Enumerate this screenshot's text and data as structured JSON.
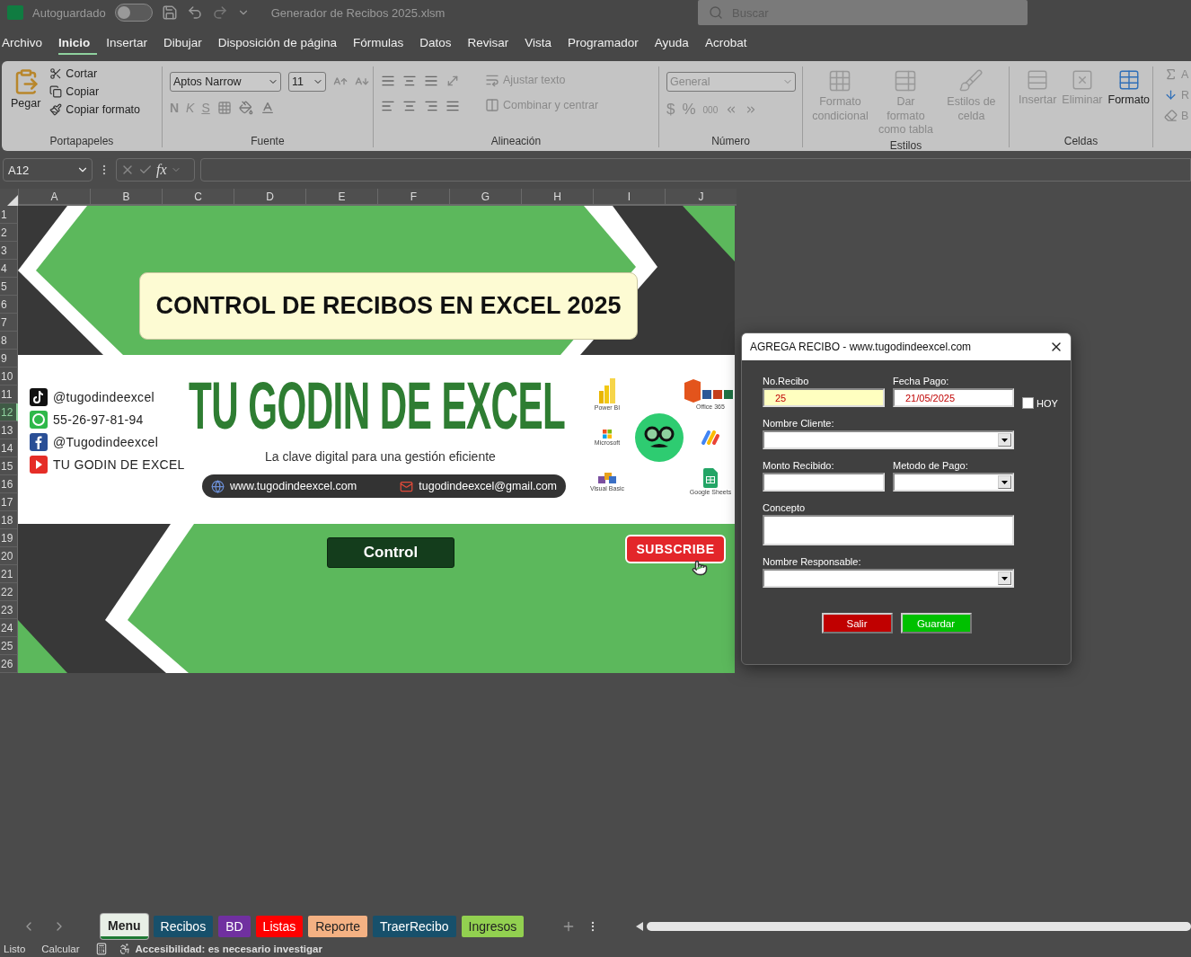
{
  "title_bar": {
    "autosave_label": "Autoguardado",
    "autosave_on": false,
    "filename": "Generador de Recibos 2025.xlsm",
    "search_placeholder": "Buscar"
  },
  "menu_tabs": [
    {
      "label": "Archivo",
      "selected": false
    },
    {
      "label": "Inicio",
      "selected": true
    },
    {
      "label": "Insertar",
      "selected": false
    },
    {
      "label": "Dibujar",
      "selected": false
    },
    {
      "label": "Disposición de página",
      "selected": false
    },
    {
      "label": "Fórmulas",
      "selected": false
    },
    {
      "label": "Datos",
      "selected": false
    },
    {
      "label": "Revisar",
      "selected": false
    },
    {
      "label": "Vista",
      "selected": false
    },
    {
      "label": "Programador",
      "selected": false
    },
    {
      "label": "Ayuda",
      "selected": false
    },
    {
      "label": "Acrobat",
      "selected": false
    }
  ],
  "ribbon": {
    "clipboard": {
      "label": "Portapapeles",
      "paste": "Pegar",
      "actions": [
        {
          "kind": "cut",
          "label": "Cortar"
        },
        {
          "kind": "copy",
          "label": "Copiar"
        },
        {
          "kind": "painter",
          "label": "Copiar formato"
        }
      ]
    },
    "font": {
      "label": "Fuente",
      "font_name": "Aptos Narrow",
      "font_size": "11",
      "styles": [
        "N",
        "K",
        "S"
      ]
    },
    "alignment": {
      "label": "Alineación",
      "actions": [
        {
          "kind": "wrap",
          "label": "Ajustar texto",
          "disabled": true
        },
        {
          "kind": "merge",
          "label": "Combinar y centrar",
          "disabled": true
        }
      ]
    },
    "number": {
      "label": "Número",
      "format": "General",
      "symbols": [
        "$",
        "%",
        "000"
      ]
    },
    "styles": {
      "label": "Estilos",
      "actions": [
        {
          "kind": "conditional",
          "label": "Formato condicional",
          "disabled": true
        },
        {
          "kind": "table",
          "label": "Dar formato como tabla",
          "disabled": true
        },
        {
          "kind": "cell",
          "label": "Estilos de celda",
          "disabled": true
        }
      ]
    },
    "cells": {
      "label": "Celdas",
      "actions": [
        {
          "kind": "insert",
          "label": "Insertar",
          "disabled": true
        },
        {
          "kind": "delete",
          "label": "Eliminar",
          "disabled": true
        },
        {
          "kind": "format",
          "label": "Formato",
          "disabled": false
        }
      ]
    },
    "editing": [
      {
        "kind": "sum",
        "label": "A"
      },
      {
        "kind": "fill",
        "label": "R"
      },
      {
        "kind": "clear",
        "label": "B"
      }
    ]
  },
  "formula_bar": {
    "name_box": "A12",
    "fx": "fx"
  },
  "columns": [
    "A",
    "B",
    "C",
    "D",
    "E",
    "F",
    "G",
    "H",
    "I",
    "J"
  ],
  "rows": [
    {
      "label": "1",
      "selected": false
    },
    {
      "label": "2",
      "selected": false
    },
    {
      "label": "3",
      "selected": false
    },
    {
      "label": "4",
      "selected": false
    },
    {
      "label": "5",
      "selected": false
    },
    {
      "label": "6",
      "selected": false
    },
    {
      "label": "7",
      "selected": false
    },
    {
      "label": "8",
      "selected": false
    },
    {
      "label": "9",
      "selected": false
    },
    {
      "label": "10",
      "selected": false
    },
    {
      "label": "11",
      "selected": false
    },
    {
      "label": "12",
      "selected": true
    },
    {
      "label": "13",
      "selected": false
    },
    {
      "label": "14",
      "selected": false
    },
    {
      "label": "15",
      "selected": false
    },
    {
      "label": "16",
      "selected": false
    },
    {
      "label": "17",
      "selected": false
    },
    {
      "label": "18",
      "selected": false
    },
    {
      "label": "19",
      "selected": false
    },
    {
      "label": "20",
      "selected": false
    },
    {
      "label": "21",
      "selected": false
    },
    {
      "label": "22",
      "selected": false
    },
    {
      "label": "23",
      "selected": false
    },
    {
      "label": "24",
      "selected": false
    },
    {
      "label": "25",
      "selected": false
    },
    {
      "label": "26",
      "selected": false
    }
  ],
  "banner": {
    "title": "CONTROL DE RECIBOS EN EXCEL 2025",
    "brand": "TU GODIN DE EXCEL",
    "tagline": "La clave digital para una gestión eficiente",
    "socials": [
      {
        "kind": "tiktok",
        "label": "@tugodindeexcel"
      },
      {
        "kind": "whatsapp",
        "label": "55-26-97-81-94"
      },
      {
        "kind": "facebook",
        "label": "@Tugodindeexcel"
      },
      {
        "kind": "youtube",
        "label": "TU GODIN DE EXCEL"
      }
    ],
    "website": "www.tugodindeexcel.com",
    "email": "tugodindeexcel@gmail.com",
    "logos": [
      {
        "kind": "powerbi",
        "label": "Power BI"
      },
      {
        "kind": "office",
        "label": "Office 365"
      },
      {
        "kind": "microsoft",
        "label": "Microsoft"
      },
      {
        "kind": "appsscript"
      },
      {
        "kind": "vba",
        "label": "Visual Basic"
      },
      {
        "kind": "sheets",
        "label": "Google Sheets"
      }
    ],
    "control_button": "Control",
    "subscribe": "SUBSCRIBE"
  },
  "dialog": {
    "title": "AGREGA RECIBO - www.tugodindeexcel.com",
    "fields": [
      {
        "kind": "text",
        "label": "No.Recibo",
        "value": "25",
        "highlighted": true,
        "wide": false
      },
      {
        "kind": "text",
        "label": "Fecha Pago:",
        "value": "21/05/2025",
        "highlighted": false,
        "wide": false
      },
      {
        "kind": "combo",
        "label": "Nombre Cliente:",
        "wide": true
      },
      {
        "kind": "text",
        "label": "Monto Recibido:",
        "highlighted": false,
        "wide": false
      },
      {
        "kind": "combo",
        "label": "Metodo de Pago:",
        "wide": false
      },
      {
        "kind": "textarea",
        "label": "Concepto",
        "wide": true
      },
      {
        "kind": "combo",
        "label": "Nombre Responsable:",
        "wide": true
      }
    ],
    "today": {
      "label": "HOY",
      "checked": false
    },
    "buttons": [
      {
        "label": "Salir",
        "color": "#c00000"
      },
      {
        "label": "Guardar",
        "color": "#00c000"
      }
    ]
  },
  "sheet_tabs": [
    {
      "label": "Menu",
      "selected": true,
      "color": "#e8efe6"
    },
    {
      "label": "Recibos",
      "selected": false,
      "color": "#17506b"
    },
    {
      "label": "BD",
      "selected": false,
      "color": "#7030a0"
    },
    {
      "label": "Listas",
      "selected": false,
      "color": "#ff0000"
    },
    {
      "label": "Reporte",
      "selected": false,
      "color": "#f4b183"
    },
    {
      "label": "TraerRecibo",
      "selected": false,
      "color": "#17506b"
    },
    {
      "label": "Ingresos",
      "selected": false,
      "color": "#92d050"
    }
  ],
  "status_bar": {
    "items": [
      "Listo",
      "Calcular"
    ],
    "accessibility": "Accesibilidad: es necesario investigar"
  }
}
